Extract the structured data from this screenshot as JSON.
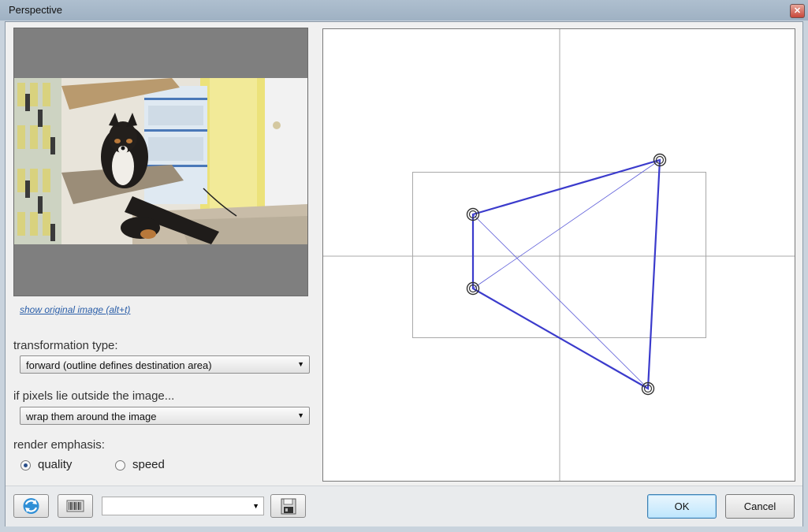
{
  "window": {
    "title": "Perspective",
    "close_glyph": "✕"
  },
  "preview": {
    "toggle_link": "show original image (alt+t)"
  },
  "transformation": {
    "label": "transformation type:",
    "selected": "forward (outline defines destination area)"
  },
  "edges": {
    "label": "if pixels lie outside the image...",
    "selected": "wrap them around the image"
  },
  "render": {
    "label": "render emphasis:",
    "options": [
      {
        "label": "quality",
        "checked": true
      },
      {
        "label": "speed",
        "checked": false
      }
    ]
  },
  "footer": {
    "reset_icon": "refresh-icon",
    "randomize_icon": "barcode-icon",
    "preset_value": "",
    "save_icon": "save-disk-icon",
    "ok_label": "OK",
    "cancel_label": "Cancel"
  },
  "colors": {
    "outline": "#3b3bcc",
    "guide": "#a8a8a8",
    "accent": "#3c7fb1"
  }
}
